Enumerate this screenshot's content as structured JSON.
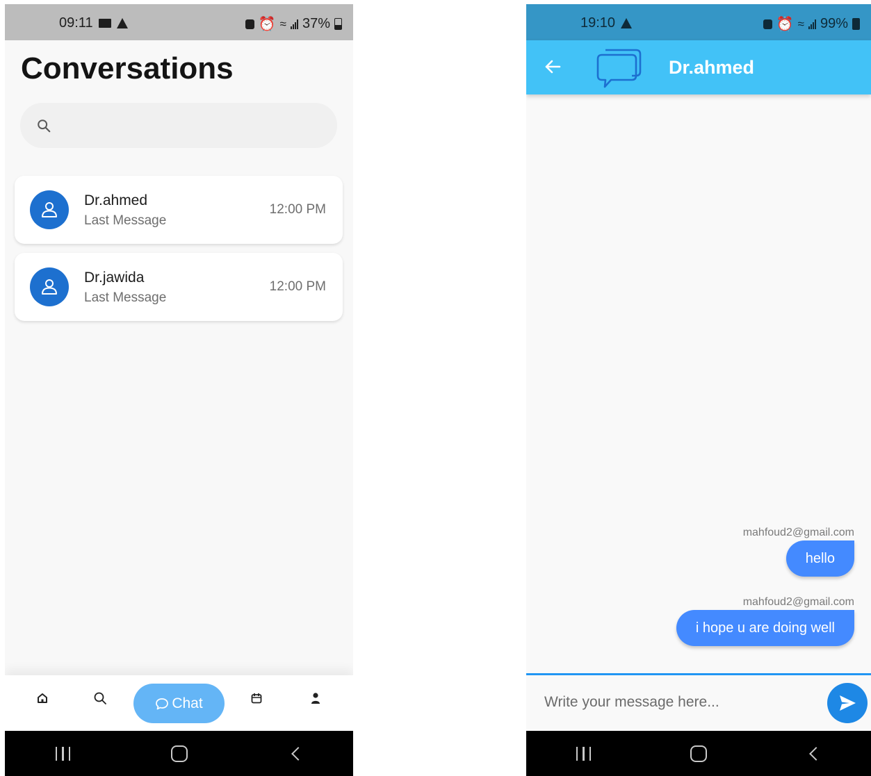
{
  "conversations_screen": {
    "status_bar": {
      "time": "09:11",
      "battery": "37%",
      "battery_level": 0.37
    },
    "title": "Conversations",
    "search": {
      "placeholder": ""
    },
    "conversations": [
      {
        "name": "Dr.ahmed",
        "last_message": "Last Message",
        "time": "12:00 PM"
      },
      {
        "name": "Dr.jawida",
        "last_message": "Last Message",
        "time": "12:00 PM"
      }
    ],
    "bottom_nav": {
      "items": [
        "home-icon",
        "search-icon",
        "chat",
        "calendar-icon",
        "profile-icon"
      ],
      "active_label": "Chat"
    }
  },
  "chat_screen": {
    "status_bar": {
      "time": "19:10",
      "battery": "99%",
      "battery_level": 0.99
    },
    "app_bar": {
      "title": "Dr.ahmed"
    },
    "messages": [
      {
        "sender": "mahfoud2@gmail.com",
        "text": "hello"
      },
      {
        "sender": "mahfoud2@gmail.com",
        "text": "i hope u are doing well"
      }
    ],
    "composer": {
      "placeholder": "Write your message here..."
    }
  },
  "colors": {
    "chat_app_bar": "#42c2f7",
    "chat_status_bar": "#3596c6",
    "avatar": "#1d70cf",
    "message_bubble": "#448aff",
    "chat_pill": "#64b5f6",
    "send_button": "#1e88e5"
  }
}
